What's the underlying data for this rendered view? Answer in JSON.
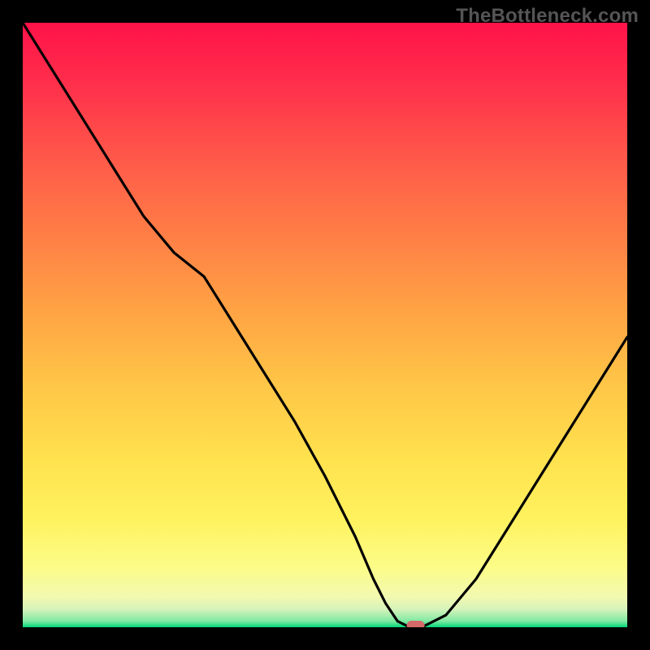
{
  "watermark": "TheBottleneck.com",
  "chart_data": {
    "type": "line",
    "title": "",
    "xlabel": "",
    "ylabel": "",
    "xlim": [
      0,
      100
    ],
    "ylim": [
      0,
      100
    ],
    "x": [
      0,
      5,
      10,
      15,
      20,
      25,
      30,
      35,
      40,
      45,
      50,
      55,
      58,
      60,
      62,
      64,
      66,
      70,
      75,
      80,
      85,
      90,
      95,
      100
    ],
    "values": [
      100,
      92,
      84,
      76,
      68,
      62,
      58,
      50,
      42,
      34,
      25,
      15,
      8,
      4,
      1,
      0,
      0,
      2,
      8,
      16,
      24,
      32,
      40,
      48
    ],
    "optimum_marker": {
      "x": 65,
      "y": 0
    },
    "background_gradient": {
      "direction": "vertical",
      "stops": [
        {
          "pos": 0,
          "color": "#ff1249"
        },
        {
          "pos": 50,
          "color": "#ffb545"
        },
        {
          "pos": 82,
          "color": "#fff25e"
        },
        {
          "pos": 100,
          "color": "#00d77a"
        }
      ]
    }
  }
}
